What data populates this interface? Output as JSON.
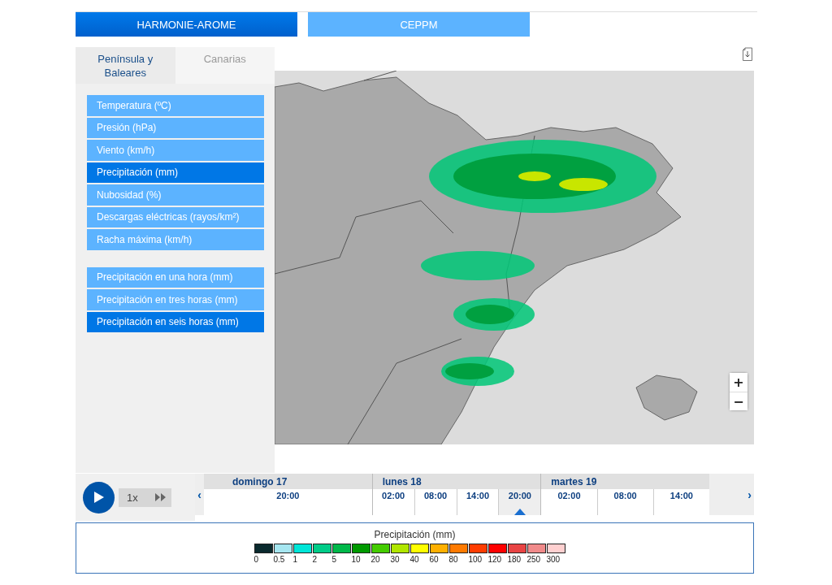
{
  "model_tabs": [
    {
      "label": "HARMONIE-AROME",
      "selected": true
    },
    {
      "label": "CEPPM",
      "selected": false
    }
  ],
  "region_tabs": [
    {
      "label": "Península y Baleares",
      "selected": true
    },
    {
      "label": "Canarias",
      "selected": false
    }
  ],
  "variable_groups": [
    [
      {
        "label": "Temperatura (ºC)",
        "selected": false
      },
      {
        "label": "Presión (hPa)",
        "selected": false
      },
      {
        "label": "Viento (km/h)",
        "selected": false
      },
      {
        "label": "Precipitación (mm)",
        "selected": true
      },
      {
        "label": "Nubosidad (%)",
        "selected": false
      },
      {
        "label": "Descargas eléctricas (rayos/km²)",
        "selected": false
      },
      {
        "label": "Racha máxima (km/h)",
        "selected": false
      }
    ],
    [
      {
        "label": "Precipitación en una hora (mm)",
        "selected": false
      },
      {
        "label": "Precipitación en tres horas (mm)",
        "selected": false
      },
      {
        "label": "Precipitación en seis horas (mm)",
        "selected": true
      }
    ]
  ],
  "map": {
    "zoom_in": "+",
    "zoom_out": "−"
  },
  "player": {
    "speed": "1x"
  },
  "timeline": {
    "prev": "‹",
    "next": "›",
    "days": [
      {
        "label": "domingo 17",
        "hours": [
          {
            "label": "20:00",
            "selected": false
          }
        ]
      },
      {
        "label": "lunes 18",
        "hours": [
          {
            "label": "02:00",
            "selected": false
          },
          {
            "label": "08:00",
            "selected": false
          },
          {
            "label": "14:00",
            "selected": false
          },
          {
            "label": "20:00",
            "selected": true
          }
        ]
      },
      {
        "label": "martes 19",
        "hours": [
          {
            "label": "02:00",
            "selected": false
          },
          {
            "label": "08:00",
            "selected": false
          },
          {
            "label": "14:00",
            "selected": false
          }
        ]
      }
    ]
  },
  "legend": {
    "title": "Precipitación (mm)",
    "classes": [
      {
        "label": "0",
        "color": "#0a2a2e"
      },
      {
        "label": "0.5",
        "color": "#a6e6f0"
      },
      {
        "label": "1",
        "color": "#00e6d8"
      },
      {
        "label": "2",
        "color": "#00cc88"
      },
      {
        "label": "5",
        "color": "#00b84a"
      },
      {
        "label": "10",
        "color": "#009a00"
      },
      {
        "label": "20",
        "color": "#44cc00"
      },
      {
        "label": "30",
        "color": "#b0e600"
      },
      {
        "label": "40",
        "color": "#ffff00"
      },
      {
        "label": "60",
        "color": "#ffb000"
      },
      {
        "label": "80",
        "color": "#ff7a00"
      },
      {
        "label": "100",
        "color": "#ff3c00"
      },
      {
        "label": "120",
        "color": "#ff0000"
      },
      {
        "label": "180",
        "color": "#e84444"
      },
      {
        "label": "250",
        "color": "#f08a8a"
      },
      {
        "label": "300",
        "color": "#ffd0d0"
      }
    ]
  }
}
